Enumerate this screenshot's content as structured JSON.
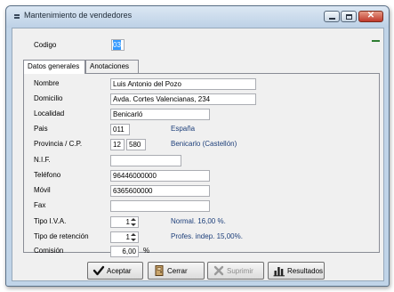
{
  "window": {
    "title": "Mantenimiento de vendedores",
    "close_glyph": "✕",
    "code_label": "Codigo",
    "code_value": "03"
  },
  "tabs": [
    {
      "label": "Datos generales",
      "active": true
    },
    {
      "label": "Anotaciones",
      "active": false
    }
  ],
  "form": {
    "nombre": {
      "label": "Nombre",
      "value": "Luis Antonio del Pozo"
    },
    "domicilio": {
      "label": "Domicilio",
      "value": "Avda. Cortes Valencianas, 234"
    },
    "localidad": {
      "label": "Localidad",
      "value": "Benicarló"
    },
    "pais": {
      "label": "Pais",
      "value": "011",
      "description": "España"
    },
    "provincia": {
      "label": "Provincia / C.P.",
      "province_value": "12",
      "cp_value": "580",
      "description": "Benicarlo (Castellón)"
    },
    "nif": {
      "label": "N.I.F.",
      "value": ""
    },
    "telefono": {
      "label": "Teléfono",
      "value": "96446000000"
    },
    "movil": {
      "label": "Móvil",
      "value": "6365600000"
    },
    "fax": {
      "label": "Fax",
      "value": ""
    },
    "tipo_iva": {
      "label": "Tipo I.V.A.",
      "value": "1",
      "description": "Normal. 16,00 %."
    },
    "tipo_retencion": {
      "label": "Tipo de retención",
      "value": "1",
      "description": "Profes. indep. 15,00%."
    },
    "comision": {
      "label": "Comisión",
      "value": "6,00",
      "unit": "%"
    }
  },
  "buttons": {
    "aceptar": {
      "label": "Aceptar",
      "enabled": true
    },
    "cerrar": {
      "label": "Cerrar",
      "enabled": true
    },
    "suprimir": {
      "label": "Suprimir",
      "enabled": false
    },
    "resultados": {
      "label": "Resultados",
      "enabled": true
    }
  },
  "icons": {
    "app": "menu-icon",
    "aceptar": "checkmark-icon",
    "cerrar": "door-icon",
    "suprimir": "delete-x-icon",
    "resultados": "bar-chart-icon"
  },
  "colors": {
    "titlebar": "#c8d9ec",
    "description_text": "#1d3f7a",
    "selection": "#3399ff",
    "close_button": "#c0392b",
    "indicator": "#2e7d32"
  }
}
